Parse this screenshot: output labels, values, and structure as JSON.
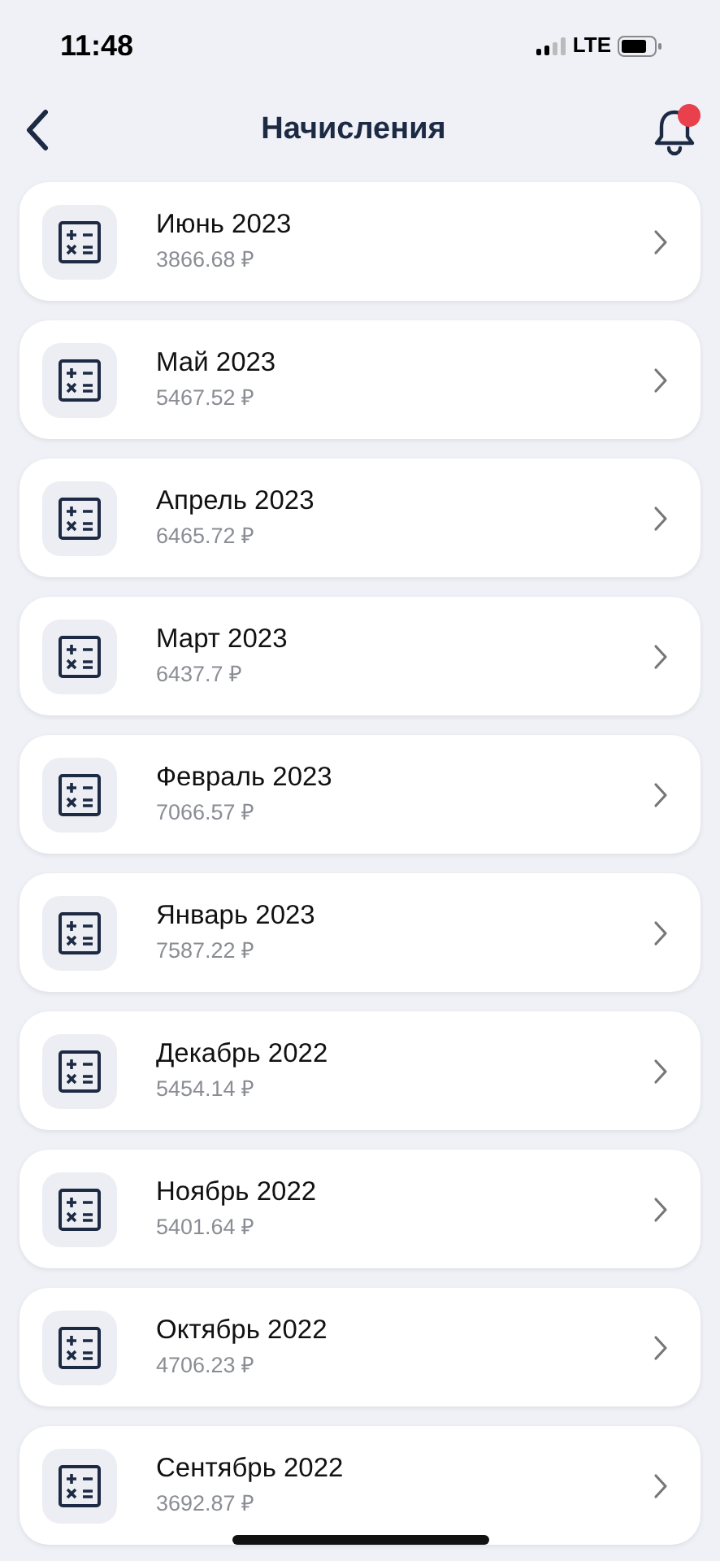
{
  "status_bar": {
    "time": "11:48",
    "network": "LTE"
  },
  "header": {
    "title": "Начисления",
    "notification_dot": true
  },
  "accruals": [
    {
      "title": "Июнь 2023",
      "amount": "3866.68 ₽"
    },
    {
      "title": "Май 2023",
      "amount": "5467.52 ₽"
    },
    {
      "title": "Апрель 2023",
      "amount": "6465.72 ₽"
    },
    {
      "title": "Март 2023",
      "amount": "6437.7 ₽"
    },
    {
      "title": "Февраль 2023",
      "amount": "7066.57 ₽"
    },
    {
      "title": "Январь 2023",
      "amount": "7587.22 ₽"
    },
    {
      "title": "Декабрь 2022",
      "amount": "5454.14 ₽"
    },
    {
      "title": "Ноябрь 2022",
      "amount": "5401.64 ₽"
    },
    {
      "title": "Октябрь 2022",
      "amount": "4706.23 ₽"
    },
    {
      "title": "Сентябрь 2022",
      "amount": "3692.87 ₽"
    }
  ]
}
